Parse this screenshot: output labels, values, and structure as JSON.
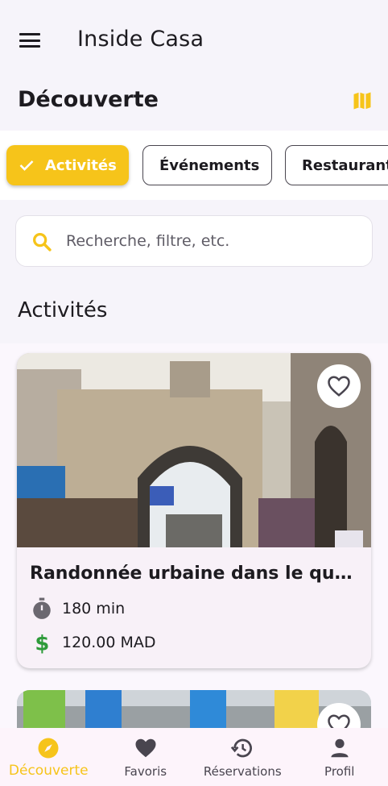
{
  "app": {
    "title": "Inside Casa"
  },
  "header": {
    "section_title": "Découverte"
  },
  "chips": [
    {
      "label": "Activités",
      "selected": true
    },
    {
      "label": "Événements",
      "selected": false
    },
    {
      "label": "Restaurants",
      "selected": false
    }
  ],
  "search": {
    "placeholder": "Recherche, filtre, etc.",
    "value": ""
  },
  "list": {
    "title": "Activités"
  },
  "cards": [
    {
      "title": "Randonnée urbaine dans le quartier des Habous",
      "duration": "180 min",
      "price": "120.00 MAD"
    }
  ],
  "nav": [
    {
      "label": "Découverte",
      "icon": "compass-icon",
      "active": true
    },
    {
      "label": "Favoris",
      "icon": "heart-icon",
      "active": false
    },
    {
      "label": "Réservations",
      "icon": "history-icon",
      "active": false
    },
    {
      "label": "Profil",
      "icon": "person-icon",
      "active": false
    }
  ],
  "colors": {
    "accent": "#f6c41a",
    "price_green": "#2e9b3a",
    "background": "#f6f4fa"
  }
}
